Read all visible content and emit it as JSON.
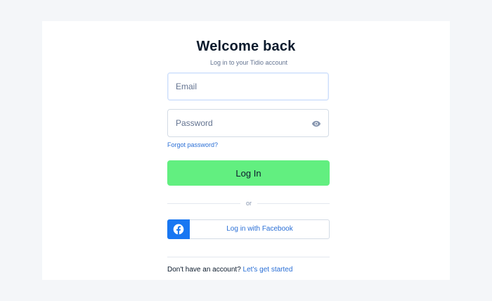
{
  "header": {
    "title": "Welcome back",
    "subtitle": "Log in to your Tidio account"
  },
  "form": {
    "email": {
      "placeholder": "Email",
      "value": ""
    },
    "password": {
      "placeholder": "Password",
      "value": "",
      "toggle_icon": "eye-icon"
    },
    "forgot_label": "Forgot password?",
    "login_label": "Log In",
    "or_label": "or",
    "facebook": {
      "label": "Log in with Facebook",
      "icon": "facebook-icon"
    }
  },
  "footer": {
    "prompt": "Don't have an account?",
    "signup_label": "Let's get started"
  },
  "colors": {
    "primary_button": "#62ef80",
    "link": "#2a6fd6",
    "facebook": "#1877f2",
    "heading": "#0b1a2c"
  }
}
